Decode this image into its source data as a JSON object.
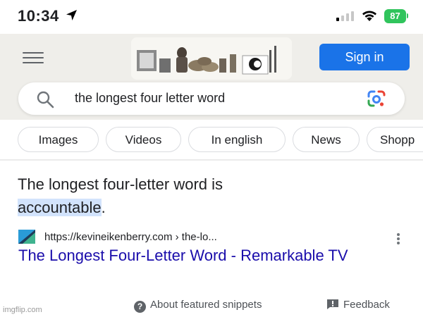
{
  "status_bar": {
    "time": "10:34",
    "battery": "87",
    "battery_color": "#30c45c",
    "icons": [
      "location-arrow-icon",
      "cellular-signal-icon",
      "wifi-icon",
      "battery-icon"
    ]
  },
  "header": {
    "menu_icon": "hamburger-menu-icon",
    "doodle_alt": "doodle-image",
    "sign_in_label": "Sign in",
    "accent": "#1a73e8"
  },
  "search": {
    "query": "the longest four letter word",
    "search_icon": "search-icon",
    "lens_icon": "google-lens-icon"
  },
  "chips": [
    "Images",
    "Videos",
    "In english",
    "News",
    "Shopp"
  ],
  "featured_snippet": {
    "text_before": "The longest four-letter word is ",
    "highlight": "accountable",
    "text_after": "."
  },
  "result": {
    "url": "https://kevineikenberry.com › the-lo...",
    "title": "The Longest Four-Letter Word - Remarkable TV",
    "link_color": "#1a0dab"
  },
  "footer": {
    "about_label": "About featured snippets",
    "feedback_label": "Feedback"
  },
  "watermark": "imgflip.com"
}
